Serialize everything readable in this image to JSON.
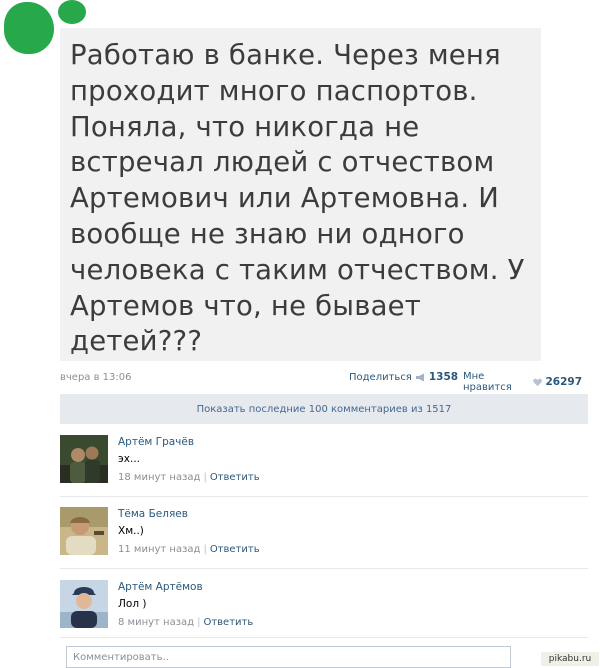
{
  "post": {
    "text": "Работаю в банке. Через меня проходит много паспортов. Поняла, что никогда не встречал людей с отчеством Артемович или Артемовна. И вообще не знаю ни одного человека с таким отчеством. У Артемов что, не бывает детей???"
  },
  "meta": {
    "date": "вчера в 13:06",
    "share_label": "Поделиться",
    "share_count": "1358",
    "like_label": "Мне нравится",
    "like_count": "26297"
  },
  "show_all_label": "Показать последние 100 комментариев из 1517",
  "comments": [
    {
      "author": "Артём Грачёв",
      "text": "эх...",
      "time": "18 минут назад",
      "reply_label": "Ответить"
    },
    {
      "author": "Тёма Беляев",
      "text": "Хм..)",
      "time": "11 минут назад",
      "reply_label": "Ответить"
    },
    {
      "author": "Артём Артёмов",
      "text": "Лол )",
      "time": "8 минут назад",
      "reply_label": "Ответить"
    }
  ],
  "compose": {
    "placeholder": "Комментировать.."
  },
  "watermark": "pikabu.ru",
  "colors": {
    "brand_green": "#27a84a",
    "link": "#2b587a",
    "muted": "#8a8f96",
    "post_bg": "#f1f1f1",
    "bar_bg": "#e6eaef"
  },
  "icons": {
    "share": "megaphone-icon",
    "like": "heart-icon"
  }
}
